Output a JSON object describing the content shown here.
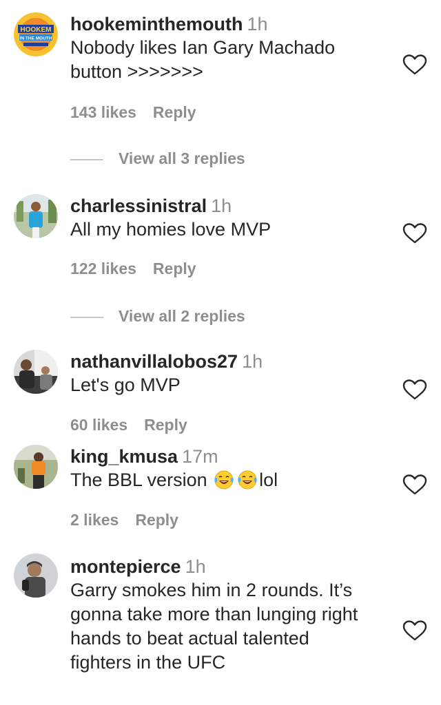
{
  "comments": [
    {
      "username": "hookeminthemouth",
      "time": "1h",
      "text_lines": [
        "Nobody likes Ian Gary Machado",
        "button >>>>>>>"
      ],
      "likes": "143 likes",
      "reply": "Reply",
      "view_replies": "View all 3 replies",
      "avatar_text": [
        "HOOKEM",
        "IN THE MOUTH"
      ]
    },
    {
      "username": "charlessinistral",
      "time": "1h",
      "text_lines": [
        "All my homies love MVP"
      ],
      "likes": "122 likes",
      "reply": "Reply",
      "view_replies": "View all 2 replies"
    },
    {
      "username": "nathanvillalobos27",
      "time": "1h",
      "text_lines": [
        "Let's go MVP"
      ],
      "likes": "60 likes",
      "reply": "Reply"
    },
    {
      "username": "king_kmusa",
      "time": "17m",
      "text_before": "The BBL version",
      "text_after": "lol",
      "emoji_name": "tears-of-joy-emoji",
      "likes": "2 likes",
      "reply": "Reply"
    },
    {
      "username": "montepierce",
      "time": "1h",
      "text_lines": [
        "Garry smokes him in 2 rounds. It’s",
        "gonna take more than lunging right",
        "hands to beat actual talented",
        "fighters in the UFC"
      ]
    }
  ],
  "icons": {
    "like": "heart-outline-icon",
    "emoji": "tears-of-joy-emoji"
  },
  "colors": {
    "text": "#262626",
    "secondary": "#8e8e8e",
    "divider": "#c7c7c7"
  }
}
